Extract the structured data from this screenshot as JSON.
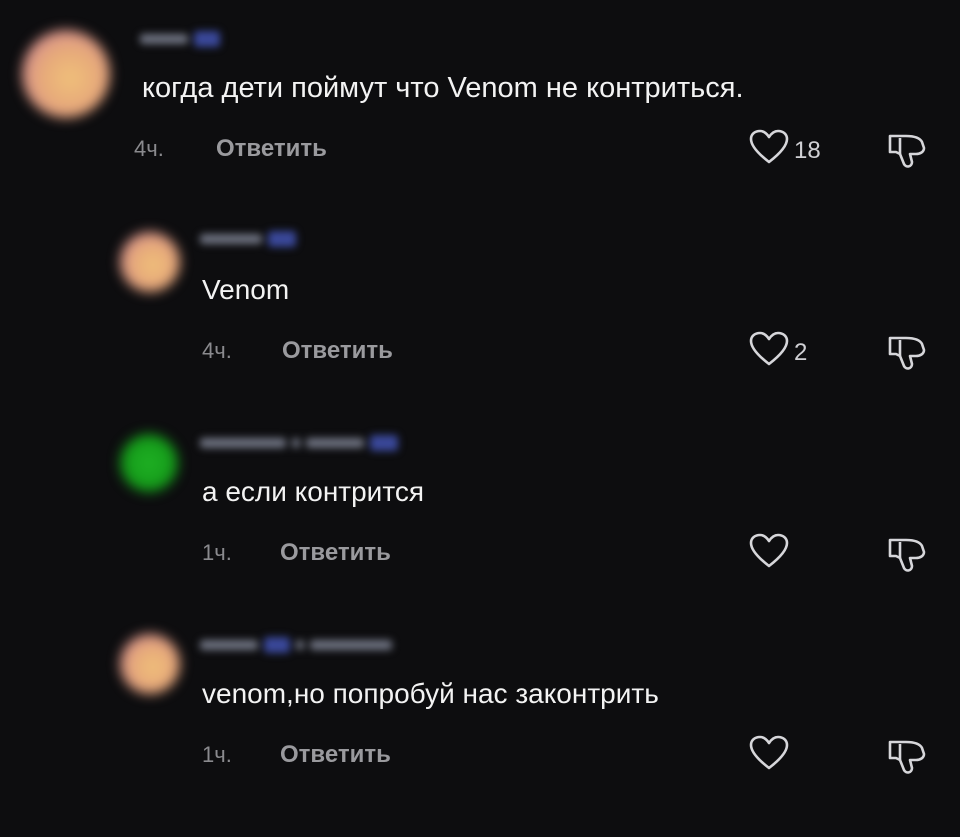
{
  "comments": [
    {
      "text": "когда дети поймут что Venom не контриться.",
      "time": "4ч.",
      "reply_label": "Ответить",
      "likes": "18",
      "avatar_color": "#e6a87a"
    },
    {
      "text": "Venom",
      "time": "4ч.",
      "reply_label": "Ответить",
      "likes": "2",
      "avatar_color": "#e6a87a"
    },
    {
      "text": "а если контрится",
      "time": "1ч.",
      "reply_label": "Ответить",
      "likes": "",
      "avatar_color": "#1fb224"
    },
    {
      "text": "venom,но попробуй нас законтрить",
      "time": "1ч.",
      "reply_label": "Ответить",
      "likes": "",
      "avatar_color": "#e6a87a"
    }
  ],
  "icons": {
    "like": "heart-outline-icon",
    "dislike": "thumbs-down-outline-icon"
  },
  "colors": {
    "background": "#0d0d0f",
    "text": "#f3f3f3",
    "muted": "#8a8a8e"
  }
}
